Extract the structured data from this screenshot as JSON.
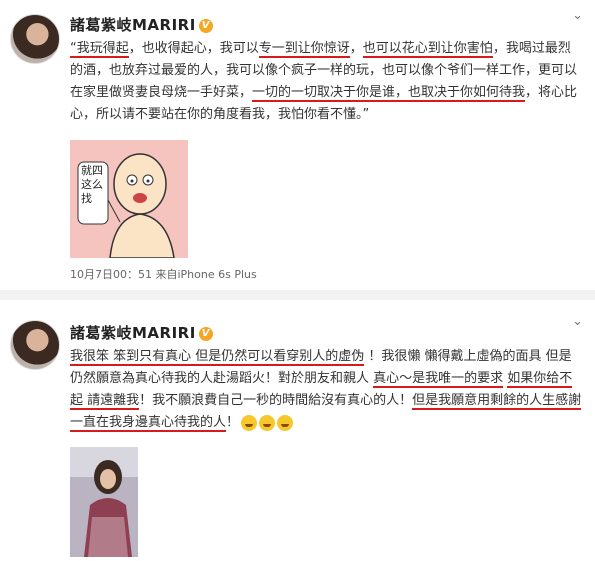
{
  "posts": [
    {
      "author": "諸葛紫岐MARIRI",
      "verified": "V",
      "chevron": "⌄",
      "text": [
        {
          "t": "“我玩得起",
          "u": true
        },
        {
          "t": "，也收得起心，我可以",
          "u": false
        },
        {
          "t": "专一到让你惊讶",
          "u": true
        },
        {
          "t": "，",
          "u": false
        },
        {
          "t": "也可以花心到让你害怕",
          "u": true
        },
        {
          "t": "，我喝过最烈的酒，也放弃过最爱的人，我可以像个疯子一样的玩，也可以像个爷们一样工作，更可以在家里做贤妻良母烧一手好菜，",
          "u": false
        },
        {
          "t": "一切的一切取决于你是谁，也取决于你如何待我",
          "u": true
        },
        {
          "t": "，将心比心，所以请不要站在你的角度看我，我怕你看不懂。”",
          "u": false
        }
      ],
      "image_text": "就四这么找",
      "meta": "10月7日00：51 来自iPhone 6s Plus"
    },
    {
      "author": "諸葛紫岐MARIRI",
      "verified": "V",
      "chevron": "⌄",
      "text": [
        {
          "t": "我很笨 笨到只有真心 但是仍然可以看穿别人的虚伪",
          "u": true
        },
        {
          "t": " ！我很懶 懶得戴上虛偽的面具 但是仍然願意為真心待我的人赴湯蹈火！對於朋友和親人 ",
          "u": false
        },
        {
          "t": "真心～是我唯一的要求",
          "u": true
        },
        {
          "t": " ",
          "u": false
        },
        {
          "t": "如果你给不起 請遠離我",
          "u": true
        },
        {
          "t": "！我不願浪費自己一秒的時間給沒有真心的人！",
          "u": false
        },
        {
          "t": "但是我願意用剩餘的人生感謝一直在我身邊真心待我的人",
          "u": true
        },
        {
          "t": "！",
          "u": false
        }
      ],
      "emojis": [
        "grin-emoji",
        "grin-emoji",
        "grin-emoji"
      ]
    }
  ]
}
